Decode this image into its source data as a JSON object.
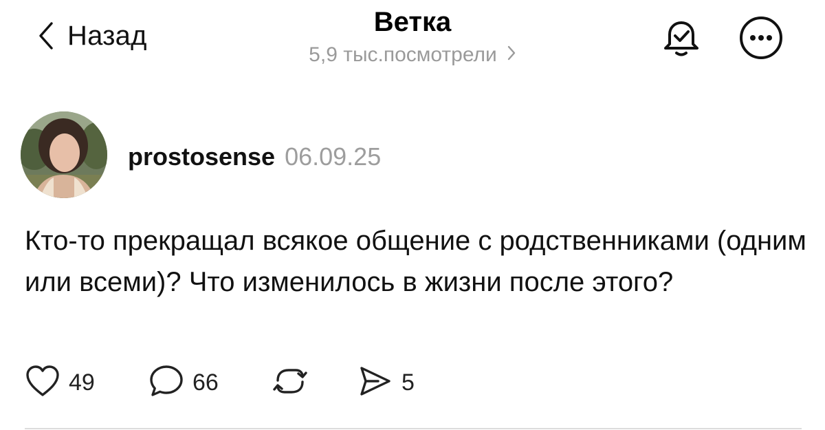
{
  "header": {
    "back_label": "Назад",
    "title": "Ветка",
    "views": "5,9 тыс.посмотрели"
  },
  "icons": {
    "back": "chevron-left-icon",
    "views_arrow": "chevron-right-icon",
    "bell": "bell-check-icon",
    "more": "more-dots-icon",
    "like": "heart-icon",
    "comment": "comment-bubble-icon",
    "repost": "repost-icon",
    "share": "send-icon"
  },
  "post": {
    "username": "prostosense",
    "date": "06.09.25",
    "text": "Кто-то прекращал всякое общение с родственниками (одним или всеми)? Что изменилось в жизни после этого?",
    "likes": "49",
    "comments": "66",
    "shares": "5"
  },
  "colors": {
    "text": "#111111",
    "muted": "#9a9a9a",
    "divider": "#dcdcdc"
  }
}
